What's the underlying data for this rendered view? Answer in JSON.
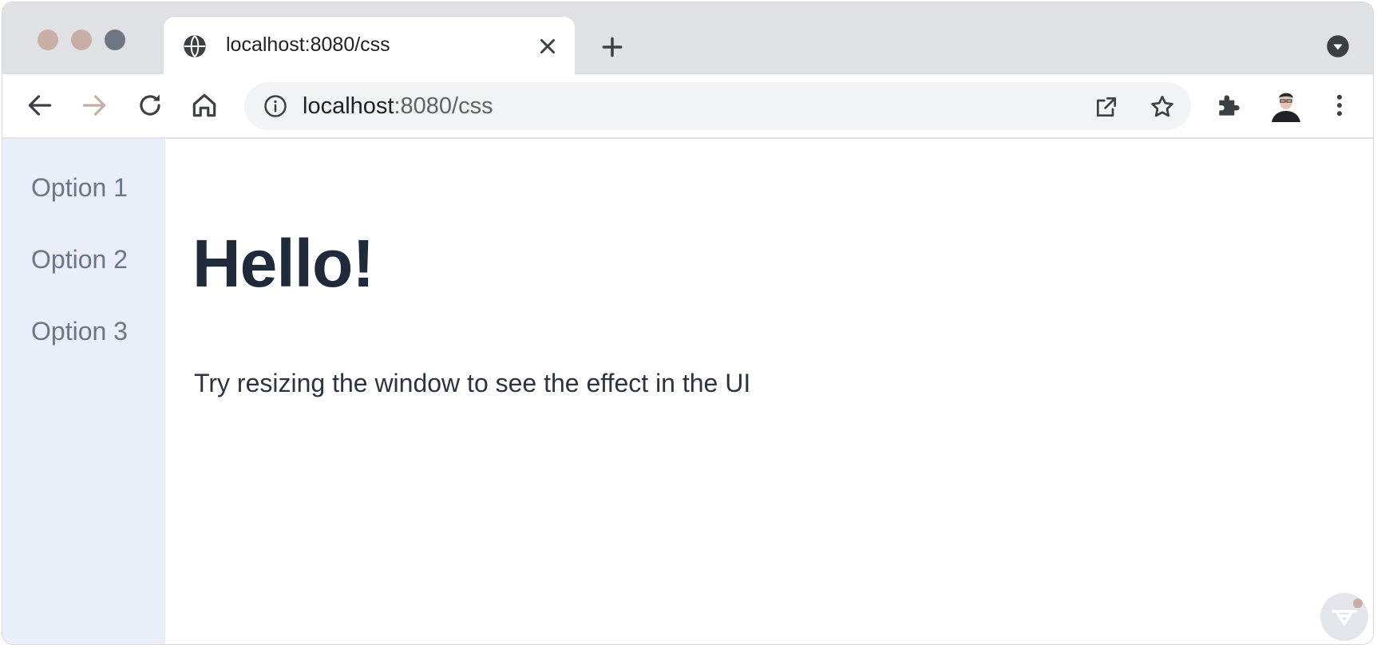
{
  "browser": {
    "tab": {
      "title": "localhost:8080/css"
    },
    "omnibox": {
      "host": "localhost",
      "path": ":8080/css"
    },
    "traffic_lights": [
      "#c9aea5",
      "#c7ada4",
      "#6e7683"
    ]
  },
  "sidebar": {
    "items": [
      {
        "label": "Option 1"
      },
      {
        "label": "Option 2"
      },
      {
        "label": "Option 3"
      }
    ]
  },
  "main": {
    "heading": "Hello!",
    "paragraph": "Try resizing the window to see the effect in the UI"
  },
  "icons": {
    "favicon": "globe-icon",
    "close": "close-icon",
    "new_tab": "plus-icon",
    "tab_search": "chevron-down-circle-icon",
    "back": "arrow-left-icon",
    "forward": "arrow-right-icon",
    "reload": "reload-icon",
    "home": "home-icon",
    "site_info": "info-icon",
    "open_in_app": "open-external-icon",
    "bookmark": "star-icon",
    "extensions": "puzzle-icon",
    "menu": "kebab-menu-icon",
    "devtools": "vaadin-icon"
  },
  "colors": {
    "sidebar_bg": "#e9eef8",
    "heading": "#1f2a3a",
    "nav_text": "#6b7686"
  }
}
